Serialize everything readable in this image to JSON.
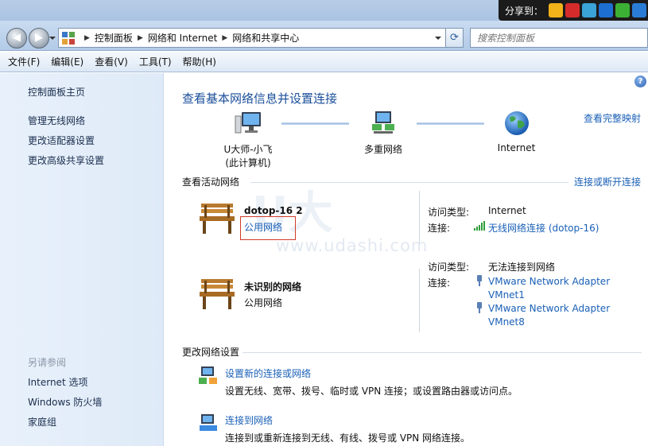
{
  "share": {
    "label": "分享到：",
    "icons": [
      {
        "name": "qzone-icon",
        "color": "#f2b21a"
      },
      {
        "name": "weibo-icon",
        "color": "#d62b2b"
      },
      {
        "name": "tencent-icon",
        "color": "#3aa3d8"
      },
      {
        "name": "renren-icon",
        "color": "#1d6fd1"
      },
      {
        "name": "wechat-icon",
        "color": "#3cb034"
      },
      {
        "name": "more-icon",
        "color": "#2a7dd6"
      }
    ]
  },
  "address": {
    "breadcrumbs": [
      "控制面板",
      "网络和 Internet",
      "网络和共享中心"
    ],
    "search_placeholder": "搜索控制面板"
  },
  "menu": [
    "文件(F)",
    "编辑(E)",
    "查看(V)",
    "工具(T)",
    "帮助(H)"
  ],
  "sidebar": {
    "home": "控制面板主页",
    "links": [
      "管理无线网络",
      "更改适配器设置",
      "更改高级共享设置"
    ],
    "see_also_header": "另请参阅",
    "see_also": [
      "Internet 选项",
      "Windows 防火墙",
      "家庭组"
    ]
  },
  "main": {
    "title": "查看基本网络信息并设置连接",
    "full_map_link": "查看完整映射",
    "map": {
      "computer_line1": "U大师-小飞",
      "computer_line2": "(此计算机)",
      "multiple": "多重网络",
      "internet": "Internet"
    },
    "active_label": "查看活动网络",
    "connect_link": "连接或断开连接",
    "networks": [
      {
        "name": "dotop-16  2",
        "type": "公用网络",
        "access_key": "访问类型:",
        "access_val": "Internet",
        "conn_key": "连接:",
        "conn_links": [
          "无线网络连接 (dotop-16)"
        ]
      },
      {
        "name": "未识别的网络",
        "type": "公用网络",
        "access_key": "访问类型:",
        "access_val": "无法连接到网络",
        "conn_key": "连接:",
        "conn_links": [
          "VMware Network Adapter",
          "VMnet1",
          "VMware Network Adapter",
          "VMnet8"
        ]
      }
    ],
    "change_label": "更改网络设置",
    "tasks": [
      {
        "title": "设置新的连接或网络",
        "desc": "设置无线、宽带、拨号、临时或 VPN 连接；或设置路由器或访问点。"
      },
      {
        "title": "连接到网络",
        "desc": "连接到或重新连接到无线、有线、拨号或 VPN 网络连接。"
      }
    ]
  },
  "watermark": "www.udashi.com"
}
